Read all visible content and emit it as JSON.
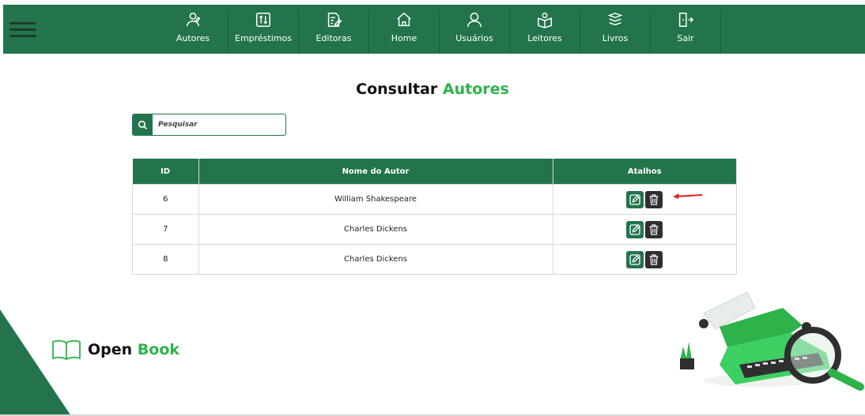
{
  "nav": {
    "menu_icon": "hamburger-icon",
    "items": [
      {
        "label": "Autores",
        "icon": "authors-icon"
      },
      {
        "label": "Empréstimos",
        "icon": "loans-icon"
      },
      {
        "label": "Editoras",
        "icon": "publishers-icon"
      },
      {
        "label": "Home",
        "icon": "home-icon"
      },
      {
        "label": "Usuários",
        "icon": "user-icon"
      },
      {
        "label": "Leitores",
        "icon": "readers-icon"
      },
      {
        "label": "Livros",
        "icon": "books-icon"
      },
      {
        "label": "Sair",
        "icon": "logout-icon"
      }
    ]
  },
  "page": {
    "title_main": "Consultar",
    "title_accent": "Autores"
  },
  "search": {
    "placeholder": "Pesquisar",
    "value": ""
  },
  "table": {
    "headers": {
      "id": "ID",
      "name": "Nome do Autor",
      "actions": "Atalhos"
    },
    "rows": [
      {
        "id": "6",
        "name": "William Shakespeare"
      },
      {
        "id": "7",
        "name": "Charles Dickens"
      },
      {
        "id": "8",
        "name": "Charles Dickens"
      }
    ]
  },
  "footer": {
    "logo_main": "Open",
    "logo_accent": "Book"
  },
  "colors": {
    "primary": "#23744c",
    "accent": "#2db34a",
    "delete": "#2f2f2f",
    "arrow": "#e02020"
  }
}
